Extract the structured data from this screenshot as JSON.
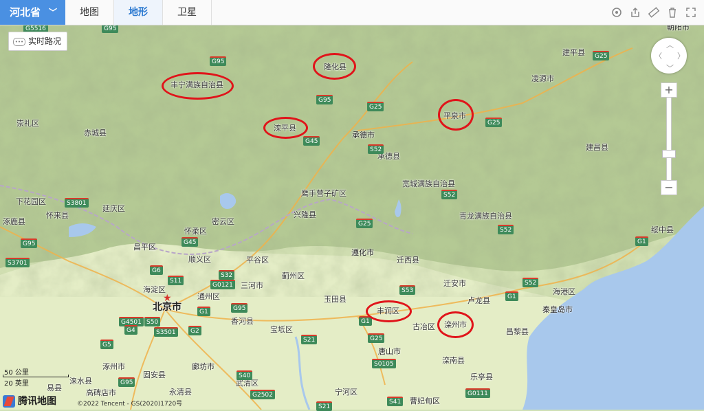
{
  "topbar": {
    "province": "河北省",
    "tabs": [
      {
        "label": "地图",
        "active": false
      },
      {
        "label": "地形",
        "active": true
      },
      {
        "label": "卫星",
        "active": false
      }
    ],
    "tools": [
      "target-icon",
      "share-icon",
      "ruler-icon",
      "trash-icon",
      "fullscreen-icon"
    ]
  },
  "traffic_label": "实时路况",
  "scale": {
    "km": "50 公里",
    "mi": "20 英里"
  },
  "logo": "腾讯地图",
  "copyright": "©2022 Tencent - GS(2020)1720号",
  "labels": {
    "chaoyang": "朝阳市",
    "jianping": "建平县",
    "lingyuan": "凌源市",
    "longhua": "隆化县",
    "fengning": "丰宁满族自治县",
    "chongli": "崇礼区",
    "chicheng": "赤城县",
    "luanping": "滦平县",
    "chengde": "承德市",
    "chengdexian": "承德县",
    "pingquan": "平泉市",
    "jianchang": "建昌县",
    "kuancheng": "宽城满族自治县",
    "yingshouyingzi": "鹰手营子矿区",
    "xinglong": "兴隆县",
    "xiahuayuan": "下花园区",
    "huailai": "怀来县",
    "yanqing": "延庆区",
    "zhuolu": "涿鹿县",
    "qinglong": "青龙满族自治县",
    "suizhong": "绥中县",
    "huairou": "怀柔区",
    "miyun": "密云区",
    "changping": "昌平区",
    "shunyi": "顺义区",
    "pinggu": "平谷区",
    "zunhua": "遵化市",
    "qianxi": "迁西县",
    "jizhou": "蓟州区",
    "qian_an": "迁安市",
    "haidian": "海淀区",
    "beijing": "北京市",
    "tongzhou": "通州区",
    "sanhe": "三河市",
    "yutian": "玉田县",
    "fengrun": "丰润区",
    "lulong": "卢龙县",
    "haigang": "海港区",
    "qinhuangdao": "秦皇岛市",
    "xianghe": "香河县",
    "baodi": "宝坻区",
    "guye": "古冶区",
    "luanzhou": "滦州市",
    "changli": "昌黎县",
    "tangshan": "唐山市",
    "luannan": "滦南县",
    "zhuozhou": "涿州市",
    "langfang": "廊坊市",
    "gu_an": "固安县",
    "laoting": "乐亭县",
    "yixian": "易县",
    "laishui": "涞水县",
    "gaobeidian": "高碑店市",
    "yongqing": "永清县",
    "wuqing": "武清区",
    "ninghe": "宁河区",
    "caofeidian": "曹妃甸区"
  },
  "shields": [
    "G95",
    "G5516",
    "G95",
    "G25",
    "G25",
    "G95",
    "G25",
    "S52",
    "G45",
    "S52",
    "S3801",
    "G95",
    "G25",
    "S52",
    "G45",
    "G1",
    "S3701",
    "G6",
    "S11",
    "S32",
    "G0121",
    "G95",
    "G1",
    "S53",
    "S52",
    "G1",
    "G4501",
    "S50",
    "G4",
    "S3501",
    "G2",
    "S21",
    "G1",
    "G25",
    "S0105",
    "G5",
    "S40",
    "G95",
    "G2502",
    "S21",
    "S41",
    "G0111"
  ],
  "colors": {
    "highlight": "#e0141a",
    "accent": "#4a90e2",
    "sea": "#a8c8ec"
  }
}
